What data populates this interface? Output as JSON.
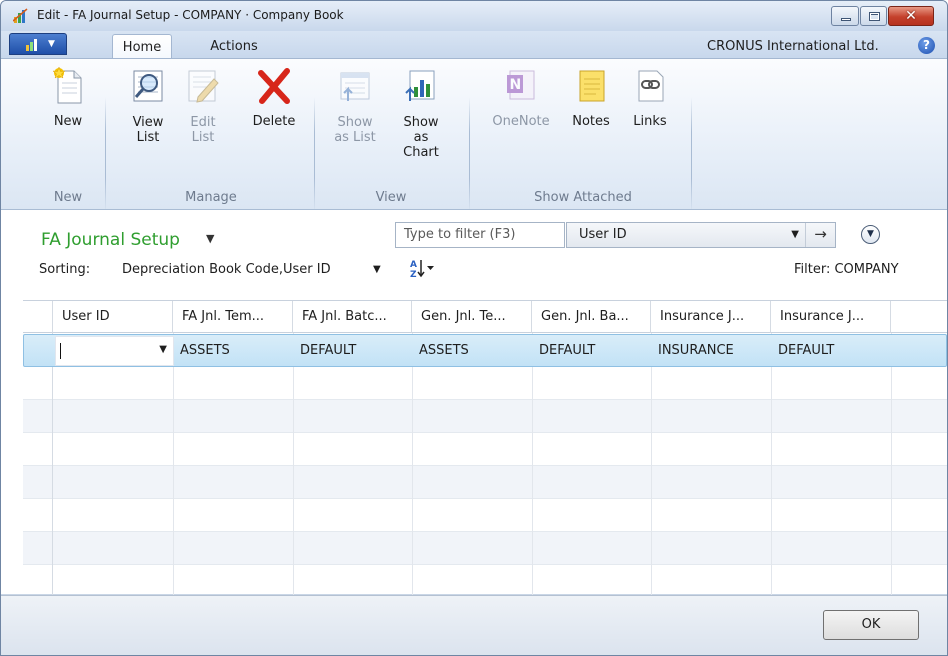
{
  "window": {
    "title": "Edit - FA Journal Setup - COMPANY · Company Book",
    "close_glyph": "✕"
  },
  "ribbon_tabs": {
    "home": "Home",
    "actions": "Actions",
    "company": "CRONUS International Ltd.",
    "help": "?"
  },
  "ribbon": {
    "new": "New",
    "view_list": "View List",
    "edit_list": "Edit List",
    "delete": "Delete",
    "show_as_list": "Show as List",
    "show_as_chart": "Show as Chart",
    "onenote": "OneNote",
    "notes": "Notes",
    "links": "Links",
    "groups": {
      "new": "New",
      "manage": "Manage",
      "view": "View",
      "show_attached": "Show Attached"
    }
  },
  "page": {
    "title": "FA Journal Setup",
    "filter_placeholder": "Type to filter (F3)",
    "filter_field": "User ID",
    "sorting_label": "Sorting:",
    "sorting_value": "Depreciation Book Code,User ID",
    "filter_status": "Filter: COMPANY"
  },
  "grid": {
    "columns": [
      "User ID",
      "FA Jnl. Tem...",
      "FA Jnl. Batc...",
      "Gen. Jnl. Te...",
      "Gen. Jnl. Ba...",
      "Insurance J...",
      "Insurance J..."
    ],
    "rows": [
      [
        "",
        "ASSETS",
        "DEFAULT",
        "ASSETS",
        "DEFAULT",
        "INSURANCE",
        "DEFAULT"
      ]
    ]
  },
  "footer": {
    "ok": "OK"
  },
  "colors": {
    "title_green": "#2f9e2f",
    "selected_row": "#c9e6f8",
    "close_red": "#c4412c"
  }
}
